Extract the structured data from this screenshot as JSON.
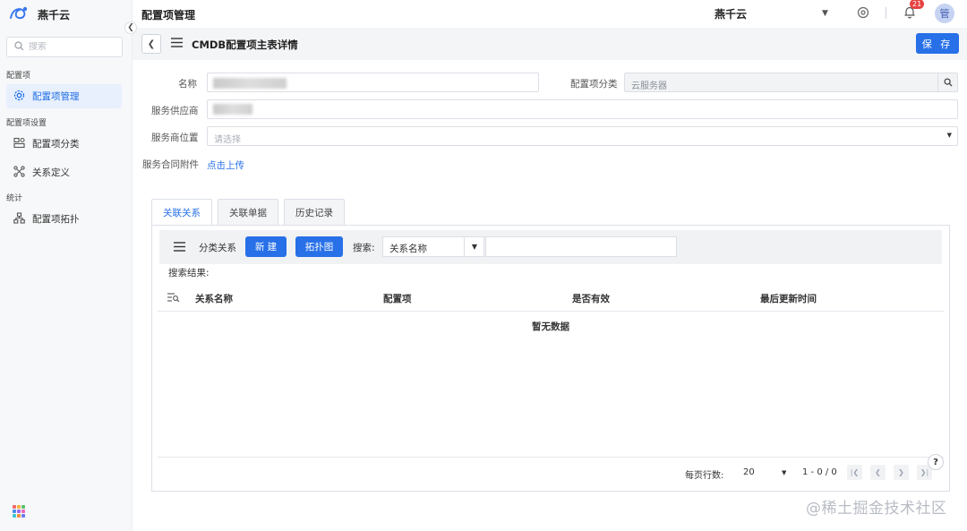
{
  "sidebar": {
    "brand": "燕千云",
    "search_placeholder": "搜索",
    "groups": [
      {
        "label": "配置项",
        "items": [
          {
            "label": "配置项管理",
            "icon": "gear-icon",
            "active": true
          }
        ]
      },
      {
        "label": "配置项设置",
        "items": [
          {
            "label": "配置项分类",
            "icon": "category-icon"
          },
          {
            "label": "关系定义",
            "icon": "relation-icon"
          }
        ]
      },
      {
        "label": "统计",
        "items": [
          {
            "label": "配置项拓扑",
            "icon": "topology-icon"
          }
        ]
      }
    ]
  },
  "topbar": {
    "title": "配置项管理",
    "tenant": "燕千云",
    "notification_count": "21",
    "avatar_text": "管"
  },
  "subbar": {
    "title": "CMDB配置项主表详情",
    "save_label": "保 存"
  },
  "form": {
    "name_label": "名称",
    "category_label": "配置项分类",
    "category_value": "云服务器",
    "supplier_label": "服务供应商",
    "location_label": "服务商位置",
    "location_placeholder": "请选择",
    "attachment_label": "服务合同附件",
    "upload_link": "点击上传"
  },
  "tabs": [
    "关联关系",
    "关联单据",
    "历史记录"
  ],
  "relations": {
    "category_label": "分类关系",
    "new_button": "新 建",
    "topology_button": "拓扑图",
    "search_label": "搜索:",
    "search_field": "关系名称",
    "result_label": "搜索结果:",
    "columns": [
      "关系名称",
      "配置项",
      "是否有效",
      "最后更新时间"
    ],
    "empty_text": "暂无数据"
  },
  "pagination": {
    "rows_label": "每页行数:",
    "rows_value": "20",
    "range": "1 - 0 / 0"
  },
  "watermark": "@稀土掘金技术社区",
  "colors": {
    "accent": "#2770e8",
    "badge": "#e64340",
    "active_bg": "#e8f0fd"
  }
}
